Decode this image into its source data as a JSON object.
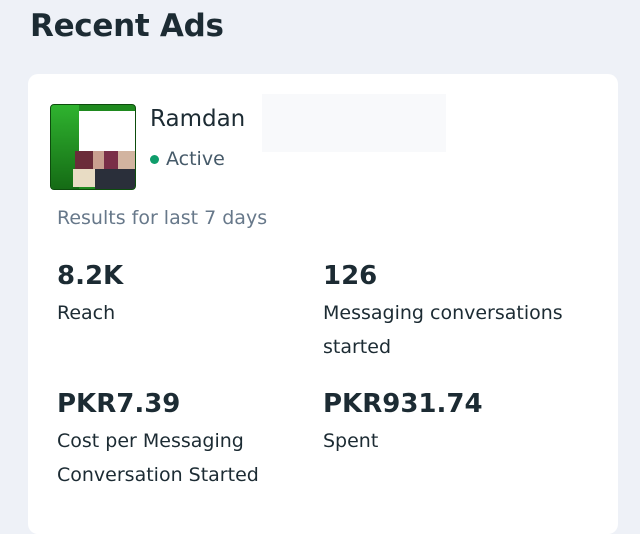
{
  "header": {
    "title": "Recent Ads"
  },
  "ad": {
    "name": "Ramdan",
    "status": "Active",
    "status_color": "#0f9d6b",
    "thumbnail_icon": "ad-thumbnail-image"
  },
  "results": {
    "period_label": "Results for last 7 days",
    "metrics": [
      {
        "value": "8.2K",
        "label": "Reach"
      },
      {
        "value": "126",
        "label": "Messaging conversations started"
      },
      {
        "value": "PKR7.39",
        "label": "Cost per Messaging Conversation Started"
      },
      {
        "value": "PKR931.74",
        "label": "Spent"
      }
    ]
  }
}
